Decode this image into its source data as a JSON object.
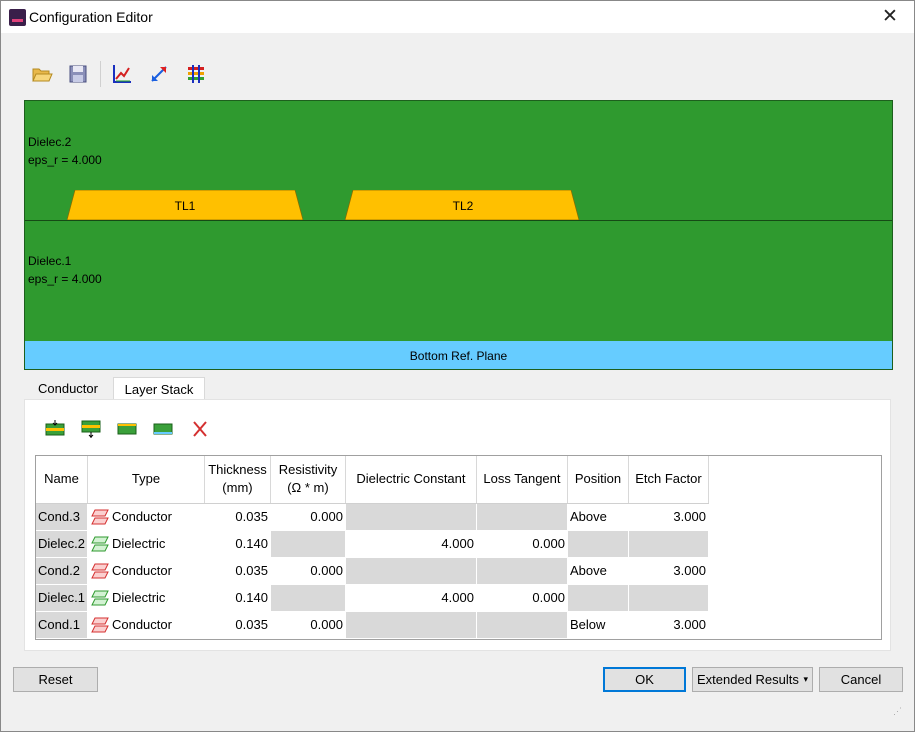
{
  "window": {
    "title": "Configuration Editor",
    "close_glyph": "✕"
  },
  "toolbar": {
    "icons": [
      "open-folder-icon",
      "save-icon",
      "axes-icon",
      "expand-arrows-icon",
      "layers-grid-icon"
    ]
  },
  "stackup": {
    "dielec2_name": "Dielec.2",
    "dielec2_eps": "eps_r = 4.000",
    "dielec1_name": "Dielec.1",
    "dielec1_eps": "eps_r = 4.000",
    "trace1": "TL1",
    "trace2": "TL2",
    "ref_plane": "Bottom Ref. Plane",
    "colors": {
      "dielectric": "#2f9a2f",
      "trace": "#ffc000",
      "plane": "#66ccff"
    }
  },
  "tabs": [
    {
      "label": "Conductor"
    },
    {
      "label": "Layer Stack"
    }
  ],
  "layer_toolbar": {
    "icons": [
      "insert-layer-above-icon",
      "insert-layer-below-icon",
      "add-dielectric-layer-icon",
      "add-conductor-layer-icon",
      "delete-layer-icon"
    ]
  },
  "table": {
    "headers": {
      "name": "Name",
      "type": "Type",
      "thickness_1": "Thickness",
      "thickness_2": "(mm)",
      "resistivity_1": "Resistivity",
      "resistivity_2": "(Ω * m)",
      "dielectric_constant": "Dielectric Constant",
      "loss_tangent": "Loss Tangent",
      "position": "Position",
      "etch_factor": "Etch Factor"
    },
    "rows": [
      {
        "name": "Cond.3",
        "type": "Conductor",
        "thickness": "0.035",
        "resistivity": "0.000",
        "dielectric_constant": "",
        "loss_tangent": "",
        "position": "Above",
        "etch_factor": "3.000"
      },
      {
        "name": "Dielec.2",
        "type": "Dielectric",
        "thickness": "0.140",
        "resistivity": "",
        "dielectric_constant": "4.000",
        "loss_tangent": "0.000",
        "position": "",
        "etch_factor": ""
      },
      {
        "name": "Cond.2",
        "type": "Conductor",
        "thickness": "0.035",
        "resistivity": "0.000",
        "dielectric_constant": "",
        "loss_tangent": "",
        "position": "Above",
        "etch_factor": "3.000"
      },
      {
        "name": "Dielec.1",
        "type": "Dielectric",
        "thickness": "0.140",
        "resistivity": "",
        "dielectric_constant": "4.000",
        "loss_tangent": "0.000",
        "position": "",
        "etch_factor": ""
      },
      {
        "name": "Cond.1",
        "type": "Conductor",
        "thickness": "0.035",
        "resistivity": "0.000",
        "dielectric_constant": "",
        "loss_tangent": "",
        "position": "Below",
        "etch_factor": "3.000"
      }
    ]
  },
  "buttons": {
    "reset": "Reset",
    "ok": "OK",
    "extended_results": "Extended Results",
    "extended_arrow": "▾",
    "cancel": "Cancel"
  }
}
